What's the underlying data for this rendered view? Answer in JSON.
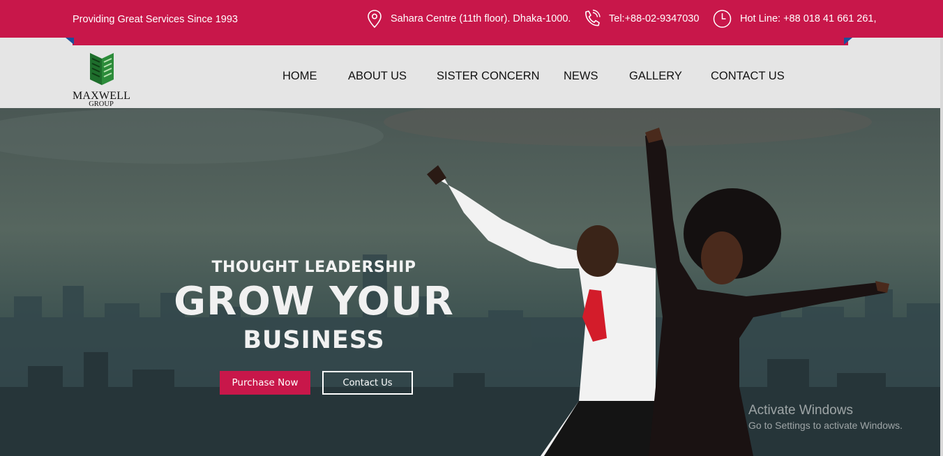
{
  "topbar": {
    "tagline": "Providing Great Services Since 1993",
    "address": "Sahara Centre (11th floor). Dhaka-1000.",
    "tel": "Tel:+88-02-9347030",
    "hotline": "Hot Line: +88 018 41 661 261,"
  },
  "logo": {
    "name": "MAXWELL",
    "sub": "GROUP"
  },
  "nav": [
    "HOME",
    "ABOUT US",
    "SISTER CONCERN",
    "NEWS",
    "GALLERY",
    "CONTACT US"
  ],
  "hero": {
    "subtitle": "THOUGHT LEADERSHIP",
    "title": "GROW YOUR",
    "title2": "BUSINESS",
    "purchase_label": "Purchase Now",
    "contact_label": "Contact Us"
  },
  "watermark": {
    "line1": "Activate Windows",
    "line2": "Go to Settings to activate Windows."
  },
  "colors": {
    "accent": "#c8174a",
    "nav_bg": "#e5e5e5",
    "logo_green": "#1f7a2e"
  }
}
